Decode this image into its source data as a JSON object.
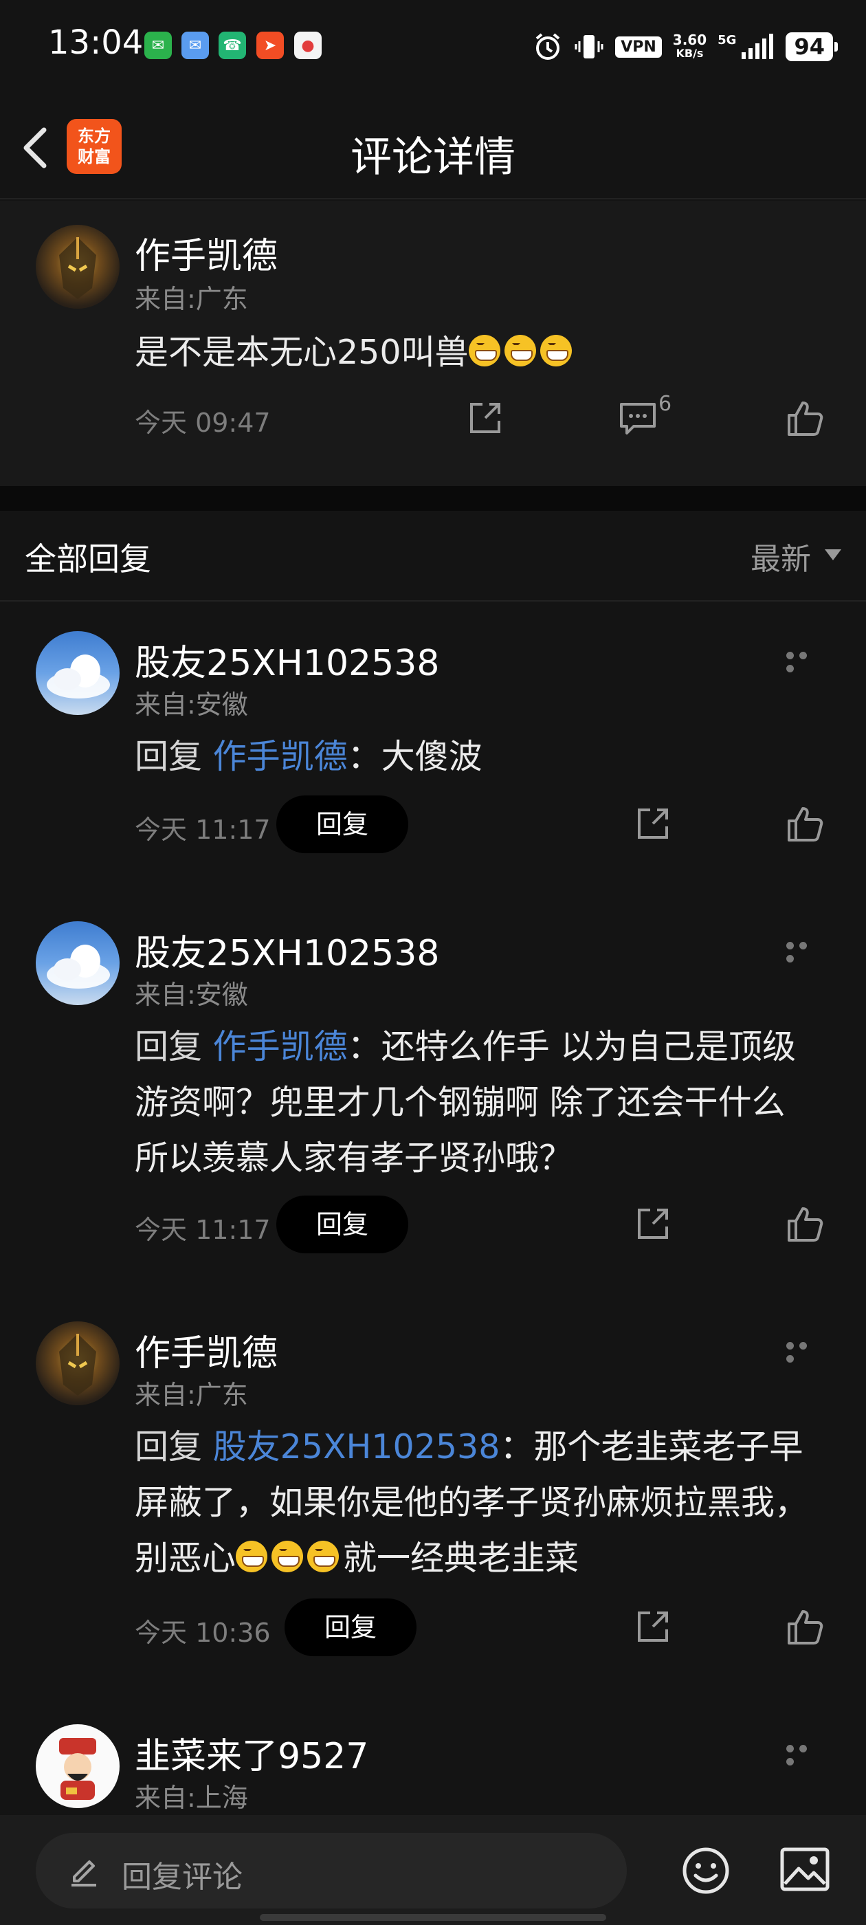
{
  "status_bar": {
    "time": "13:04",
    "vpn": "VPN",
    "net_speed_value": "3.60",
    "net_speed_unit": "KB/s",
    "network": "5G",
    "battery": "94"
  },
  "header": {
    "app_logo_line1": "东方",
    "app_logo_line2": "财富",
    "title": "评论详情"
  },
  "main_comment": {
    "username": "作手凯德",
    "location": "来自:广东",
    "text": "是不是本无心250叫兽",
    "emoji_count": 3,
    "time": "今天 09:47",
    "reply_count": "6"
  },
  "replies_section": {
    "title": "全部回复",
    "sort": "最新"
  },
  "replies": [
    {
      "username": "股友25XH102538",
      "location": "来自:安徽",
      "reply_prefix": "回复",
      "reply_to": "作手凯德",
      "text": "：大傻波",
      "time": "今天 11:17",
      "reply_label": "回复"
    },
    {
      "username": "股友25XH102538",
      "location": "来自:安徽",
      "reply_prefix": "回复",
      "reply_to": "作手凯德",
      "text": "：还特么作手 以为自己是顶级游资啊？兜里才几个钢镚啊 除了还会干什么 所以羡慕人家有孝子贤孙哦？",
      "time": "今天 11:17",
      "reply_label": "回复"
    },
    {
      "username": "作手凯德",
      "location": "来自:广东",
      "reply_prefix": "回复",
      "reply_to": "股友25XH102538",
      "text": "：那个老韭菜老子早屏蔽了，如果你是他的孝子贤孙麻烦拉黑我，别恶心",
      "text_after_emoji": "就一经典老韭菜",
      "emoji_count": 3,
      "time": "今天 10:36",
      "reply_label": "回复"
    },
    {
      "username": "韭菜来了9527",
      "location": "来自:上海"
    }
  ],
  "bottom_bar": {
    "placeholder": "回复评论"
  },
  "colors": {
    "background": "#141414",
    "link": "#4b86d8",
    "brand": "#f2541b"
  },
  "icons": [
    "back-icon",
    "share-icon",
    "comment-icon",
    "like-icon",
    "more-icon",
    "edit-icon",
    "emoji-icon",
    "image-icon"
  ]
}
